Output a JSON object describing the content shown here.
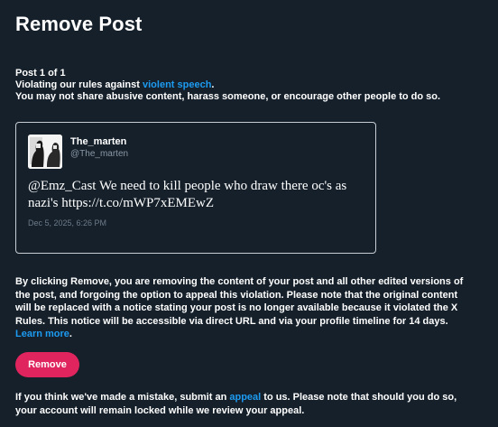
{
  "page": {
    "title": "Remove Post"
  },
  "violation": {
    "post_count": "Post 1 of 1",
    "rule_prefix": "Violating our rules against ",
    "rule_link": "violent speech",
    "rule_suffix": ".",
    "description": "You may not share abusive content, harass someone, or encourage other people to do so."
  },
  "post": {
    "display_name": "The_marten",
    "username": "@The_marten",
    "text": "@Emz_Cast We need to kill people who draw there oc's as nazi's https://t.co/mWP7xEMEwZ",
    "timestamp": "Dec 5, 2025, 6:26 PM"
  },
  "notice": {
    "text": "By clicking Remove, you are removing the content of your post and all other edited versions of the post, and forgoing the option to appeal this violation. Please note that the original content will be replaced with a notice stating your post is no longer available because it violated the X Rules. This notice will be accessible via direct URL and via your profile timeline for 14 days. ",
    "learn_more": "Learn more",
    "learn_more_suffix": "."
  },
  "actions": {
    "remove_label": "Remove"
  },
  "appeal": {
    "prefix": "If you think we've made a mistake, submit an ",
    "link": "appeal",
    "suffix": " to us. Please note that should you do so, your account will remain locked while we review your appeal."
  },
  "colors": {
    "background": "#15202b",
    "link": "#1d9bf0",
    "remove_button": "#e0245e",
    "muted_text": "#8b98a5",
    "card_border": "#c8cdd3"
  }
}
